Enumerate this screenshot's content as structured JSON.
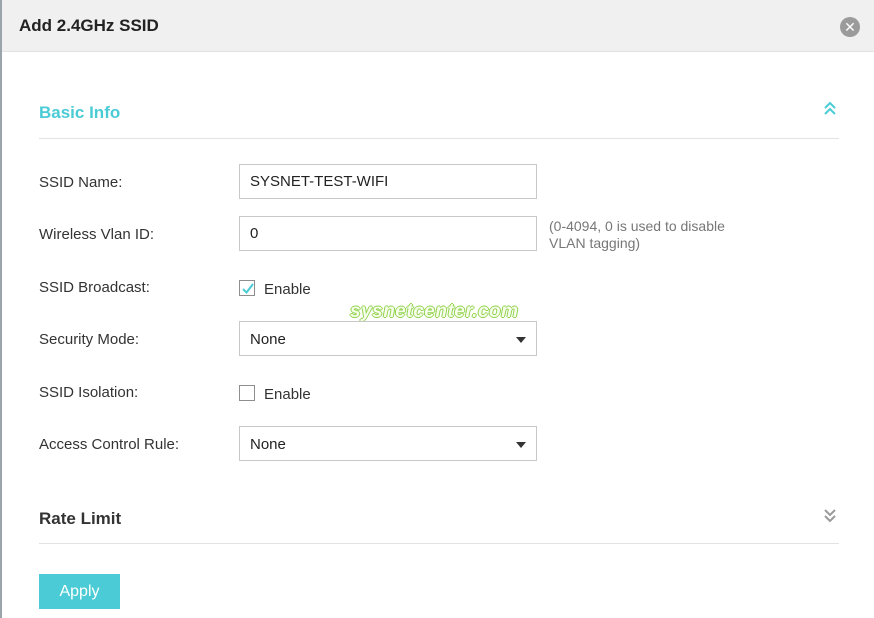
{
  "dialog": {
    "title": "Add 2.4GHz SSID",
    "close_icon": "close-icon"
  },
  "basic_info": {
    "title": "Basic Info",
    "collapse_icon": "chevron-double-up-icon",
    "ssid_name": {
      "label": "SSID Name:",
      "value": "SYSNET-TEST-WIFI"
    },
    "vlan_id": {
      "label": "Wireless Vlan ID:",
      "value": "0",
      "hint_line1": "(0-4094, 0 is used to disable",
      "hint_line2": "VLAN tagging)"
    },
    "ssid_broadcast": {
      "label": "SSID Broadcast:",
      "option_label": "Enable",
      "checked": true
    },
    "security_mode": {
      "label": "Security Mode:",
      "selected": "None"
    },
    "ssid_isolation": {
      "label": "SSID Isolation:",
      "option_label": "Enable",
      "checked": false
    },
    "access_control_rule": {
      "label": "Access Control Rule:",
      "selected": "None"
    }
  },
  "rate_limit": {
    "title": "Rate Limit",
    "expand_icon": "chevron-double-down-icon"
  },
  "watermark": "sysnetcenter.com",
  "actions": {
    "apply_label": "Apply"
  },
  "colors": {
    "accent": "#4acbd6",
    "title_bar": "#f0f0f0",
    "watermark_outline": "#8fd24a"
  }
}
